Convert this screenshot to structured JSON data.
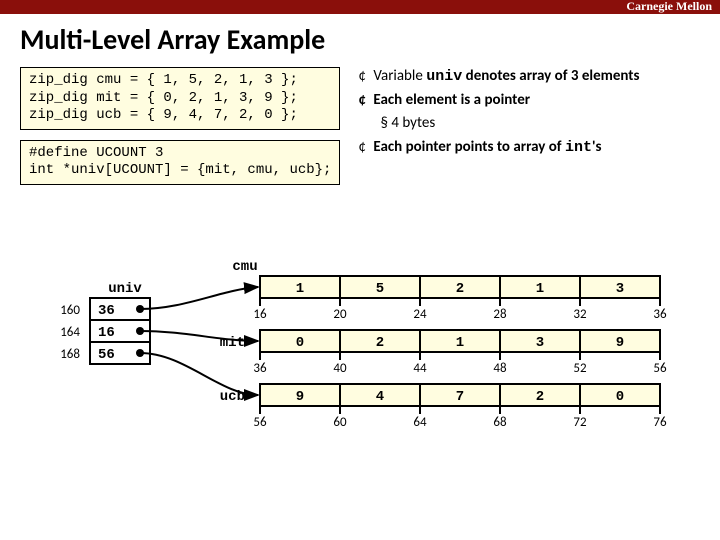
{
  "brand": "Carnegie Mellon",
  "title": "Multi-Level Array Example",
  "code1": "zip_dig cmu = { 1, 5, 2, 1, 3 };\nzip_dig mit = { 0, 2, 1, 3, 9 };\nzip_dig ucb = { 9, 4, 7, 2, 0 };",
  "code2": "#define UCOUNT 3\nint *univ[UCOUNT] = {mit, cmu, ucb};",
  "bullets": {
    "b1a_pre": "Variable ",
    "b1a_mono": "univ",
    "b1a_post": " denotes array of 3 elements",
    "b2": "Each element is a pointer",
    "b2s": "4 bytes",
    "b3_pre": "Each pointer points to array of ",
    "b3_mono": "int",
    "b3_post": "'s"
  },
  "labels": {
    "univ": "univ",
    "cmu": "cmu",
    "mit": "mit",
    "ucb": "ucb"
  },
  "univ_table": {
    "addrs": [
      "160",
      "164",
      "168"
    ],
    "vals": [
      "36",
      "16",
      "56"
    ]
  },
  "arrays": {
    "cmu": {
      "vals": [
        "1",
        "5",
        "2",
        "1",
        "3"
      ],
      "addrs": [
        "16",
        "20",
        "24",
        "28",
        "32",
        "36"
      ]
    },
    "mit": {
      "vals": [
        "0",
        "2",
        "1",
        "3",
        "9"
      ],
      "addrs": [
        "36",
        "40",
        "44",
        "48",
        "52",
        "56"
      ]
    },
    "ucb": {
      "vals": [
        "9",
        "4",
        "7",
        "2",
        "0"
      ],
      "addrs": [
        "56",
        "60",
        "64",
        "68",
        "72",
        "76"
      ]
    }
  }
}
